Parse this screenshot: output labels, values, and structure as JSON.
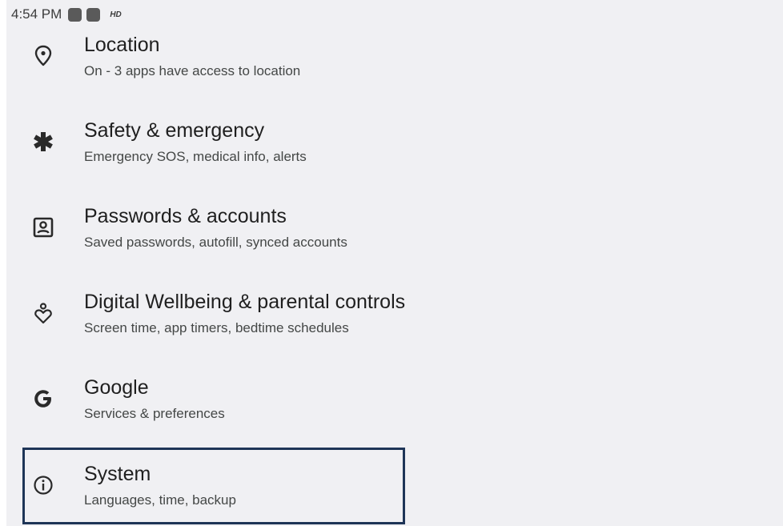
{
  "status_bar": {
    "time": "4:54 PM",
    "hd_label": "HD"
  },
  "settings": {
    "items": [
      {
        "icon": "location-pin-icon",
        "title": "Location",
        "summary": "On - 3 apps have access to location"
      },
      {
        "icon": "asterisk-icon",
        "title": "Safety & emergency",
        "summary": "Emergency SOS, medical info, alerts"
      },
      {
        "icon": "account-box-icon",
        "title": "Passwords & accounts",
        "summary": "Saved passwords, autofill, synced accounts"
      },
      {
        "icon": "wellbeing-icon",
        "title": "Digital Wellbeing & parental controls",
        "summary": "Screen time, app timers, bedtime schedules"
      },
      {
        "icon": "google-g-icon",
        "title": "Google",
        "summary": "Services & preferences"
      },
      {
        "icon": "info-icon",
        "title": "System",
        "summary": "Languages, time, backup"
      }
    ],
    "focused_item": "System"
  },
  "colors": {
    "background": "#f0f0f3",
    "focus_border": "#1e3557",
    "title_text": "#1f1f1f",
    "summary_text": "#444746"
  }
}
